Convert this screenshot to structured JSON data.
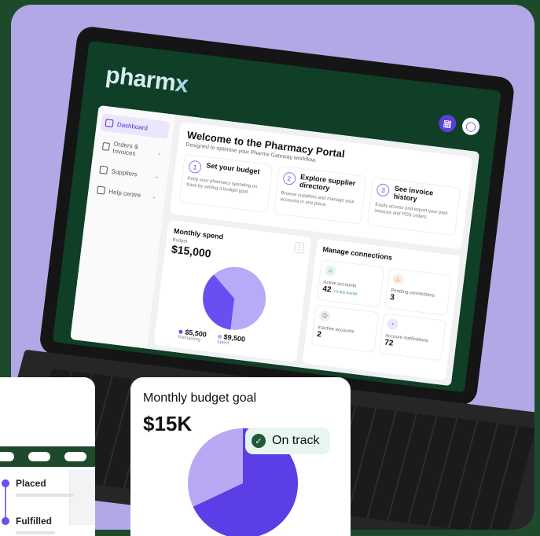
{
  "brand": {
    "logo": "pharm",
    "logo_mark": "x"
  },
  "sidebar": {
    "items": [
      {
        "label": "Dashboard",
        "active": true
      },
      {
        "label": "Orders & Invoices",
        "active": false
      },
      {
        "label": "Suppliers",
        "active": false
      },
      {
        "label": "Help centre",
        "active": false
      }
    ]
  },
  "welcome": {
    "title": "Welcome to the Pharmacy Portal",
    "subtitle": "Designed to optimise your Pharmx Gateway workflow.",
    "steps": [
      {
        "num": "1",
        "title": "Set your budget",
        "desc": "Keep your pharmacy spending on track by setting a budget goal."
      },
      {
        "num": "2",
        "title": "Explore supplier directory",
        "desc": "Browse suppliers and manage your accounts in one place."
      },
      {
        "num": "3",
        "title": "See invoice history",
        "desc": "Easily access and export your past invoices and POS orders."
      }
    ]
  },
  "monthly_spend": {
    "title": "Monthly spend",
    "budget_label": "Budget",
    "budget_value": "$15,000",
    "remaining_value": "$5,500",
    "remaining_label": "Remaining",
    "spent_value": "$9,500",
    "spent_label": "Spent",
    "remaining_fraction": 0.367,
    "colors": {
      "remaining": "#6a4ef0",
      "spent": "#b8aaf8"
    }
  },
  "connections": {
    "title": "Manage connections",
    "cards": [
      {
        "label": "Active accounts",
        "value": "42",
        "note": "+3 this month"
      },
      {
        "label": "Pending connections",
        "value": "3",
        "note": ""
      },
      {
        "label": "Inactive accounts",
        "value": "2",
        "note": ""
      },
      {
        "label": "Account notifications",
        "value": "72",
        "note": ""
      }
    ]
  },
  "order_status": {
    "steps": [
      "Placed",
      "Fulfilled"
    ]
  },
  "budget_goal": {
    "title": "Monthly budget goal",
    "value": "$15K",
    "status": "On track",
    "spent_fraction": 0.68,
    "colors": {
      "spent": "#5b3ee6",
      "remaining": "#b9a8f3"
    }
  }
}
